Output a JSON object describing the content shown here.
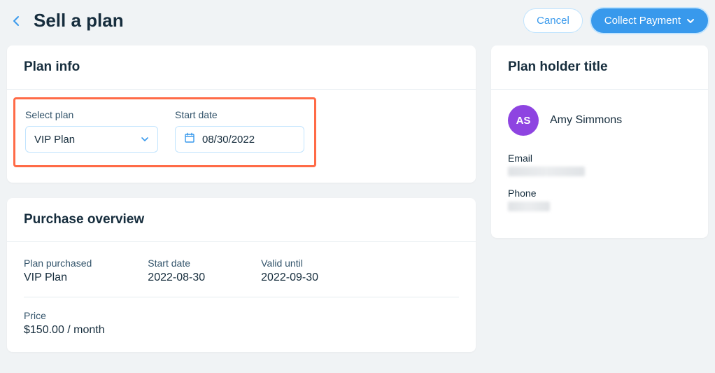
{
  "header": {
    "title": "Sell a plan",
    "cancel_label": "Cancel",
    "collect_label": "Collect Payment"
  },
  "plan_info": {
    "title": "Plan info",
    "select_plan_label": "Select plan",
    "select_plan_value": "VIP Plan",
    "start_date_label": "Start date",
    "start_date_value": "08/30/2022"
  },
  "purchase_overview": {
    "title": "Purchase overview",
    "plan_purchased_label": "Plan purchased",
    "plan_purchased_value": "VIP Plan",
    "start_date_label": "Start date",
    "start_date_value": "2022-08-30",
    "valid_until_label": "Valid until",
    "valid_until_value": "2022-09-30",
    "price_label": "Price",
    "price_value": "$150.00 / month"
  },
  "plan_holder": {
    "title": "Plan holder title",
    "avatar_initials": "AS",
    "name": "Amy Simmons",
    "email_label": "Email",
    "phone_label": "Phone"
  }
}
